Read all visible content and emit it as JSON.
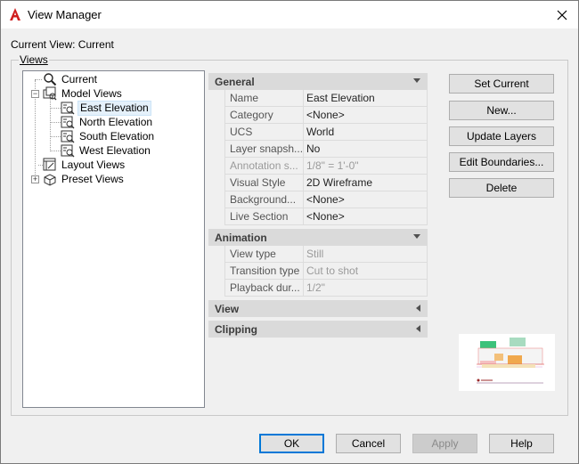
{
  "window": {
    "title": "View Manager",
    "app_icon": "autocad-a-icon",
    "close_icon": "close-icon"
  },
  "current_view": "Current View: Current",
  "views_group_label": "Views",
  "tree": {
    "items": [
      {
        "label": "Current",
        "icon": "magnifier-icon"
      },
      {
        "label": "Model Views",
        "icon": "model-views-icon",
        "expander": "−"
      },
      {
        "label": "East Elevation",
        "icon": "named-view-icon",
        "selected": true
      },
      {
        "label": "North Elevation",
        "icon": "named-view-icon"
      },
      {
        "label": "South Elevation",
        "icon": "named-view-icon"
      },
      {
        "label": "West Elevation",
        "icon": "named-view-icon"
      },
      {
        "label": "Layout Views",
        "icon": "layout-views-icon"
      },
      {
        "label": "Preset Views",
        "icon": "preset-views-icon",
        "expander": "+"
      }
    ]
  },
  "properties": {
    "general": {
      "title": "General",
      "rows": [
        {
          "name": "Name",
          "value": "East Elevation"
        },
        {
          "name": "Category",
          "value": "<None>"
        },
        {
          "name": "UCS",
          "value": "World"
        },
        {
          "name": "Layer snapsh...",
          "value": "No"
        },
        {
          "name": "Annotation s...",
          "value": "1/8\" = 1'-0\"",
          "disabled": true
        },
        {
          "name": "Visual Style",
          "value": "2D Wireframe"
        },
        {
          "name": "Background...",
          "value": "<None>"
        },
        {
          "name": "Live Section",
          "value": "<None>"
        }
      ]
    },
    "animation": {
      "title": "Animation",
      "rows": [
        {
          "name": "View type",
          "value": "Still"
        },
        {
          "name": "Transition type",
          "value": "Cut to shot"
        },
        {
          "name": "Playback dur...",
          "value": "1/2\""
        }
      ]
    },
    "view": {
      "title": "View"
    },
    "clipping": {
      "title": "Clipping"
    }
  },
  "buttons": {
    "set_current": "Set Current",
    "new": "New...",
    "update_layers": "Update Layers",
    "edit_boundaries": "Edit Boundaries...",
    "delete": "Delete",
    "ok": "OK",
    "cancel": "Cancel",
    "apply": "Apply",
    "help": "Help"
  },
  "colors": {
    "accent": "#0078d7",
    "selection": "#e5f1fb",
    "header": "#dadada"
  }
}
